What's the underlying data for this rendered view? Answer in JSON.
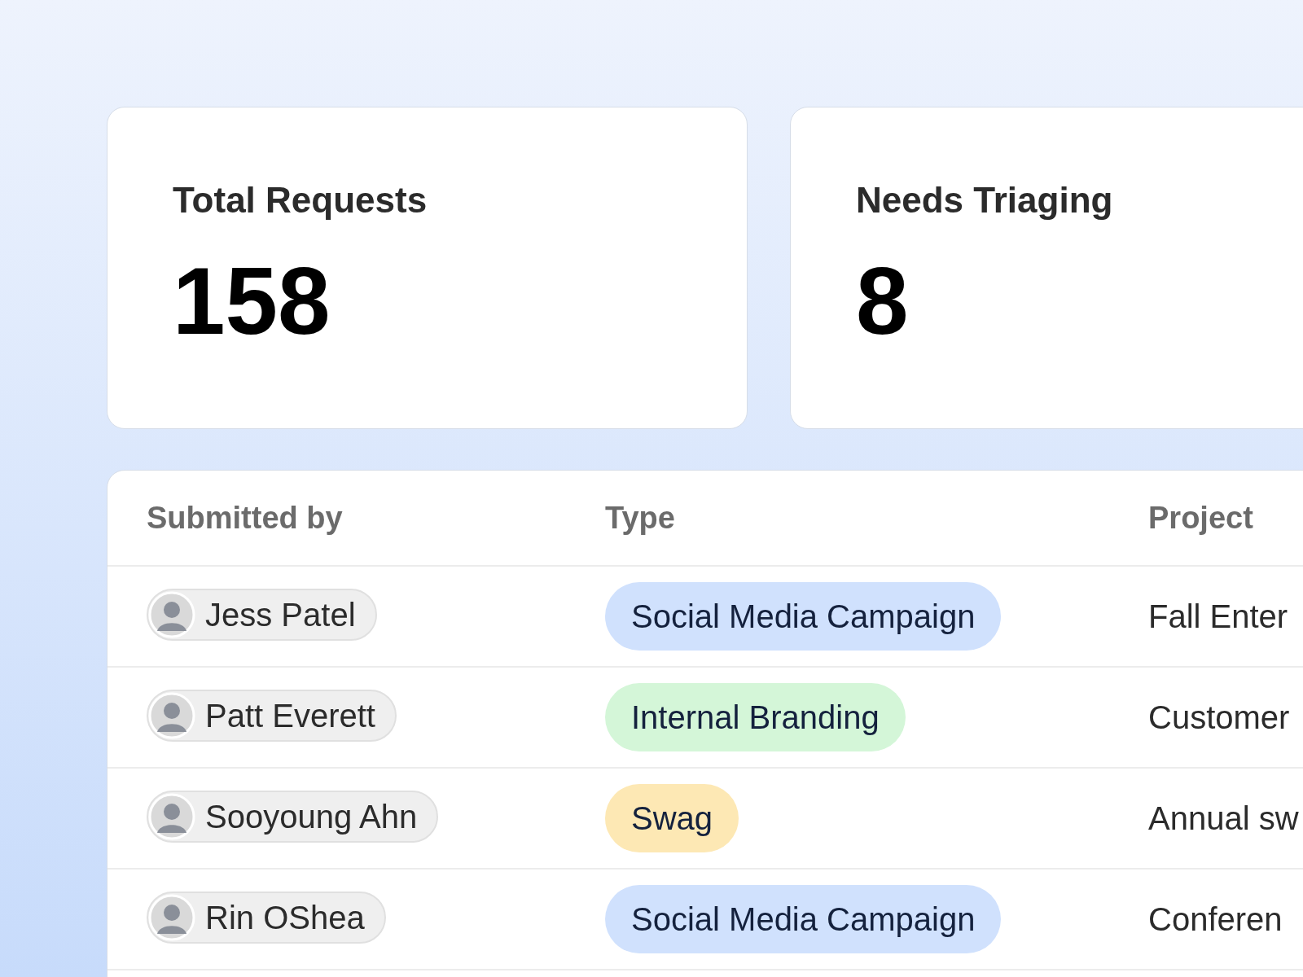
{
  "stats": [
    {
      "label": "Total Requests",
      "value": "158"
    },
    {
      "label": "Needs Triaging",
      "value": "8"
    }
  ],
  "table": {
    "columns": [
      "Submitted by",
      "Type",
      "Project"
    ],
    "rows": [
      {
        "submitted_by": "Jess Patel",
        "type": {
          "label": "Social Media Campaign",
          "color": "#d0e1fd"
        },
        "project": "Fall Enter"
      },
      {
        "submitted_by": "Patt Everett",
        "type": {
          "label": "Internal Branding",
          "color": "#d4f6d8"
        },
        "project": "Customer"
      },
      {
        "submitted_by": "Sooyoung Ahn",
        "type": {
          "label": "Swag",
          "color": "#fde8b4"
        },
        "project": "Annual sw"
      },
      {
        "submitted_by": "Rin OShea",
        "type": {
          "label": "Social Media Campaign",
          "color": "#d0e1fd"
        },
        "project": "Conferen"
      }
    ]
  }
}
